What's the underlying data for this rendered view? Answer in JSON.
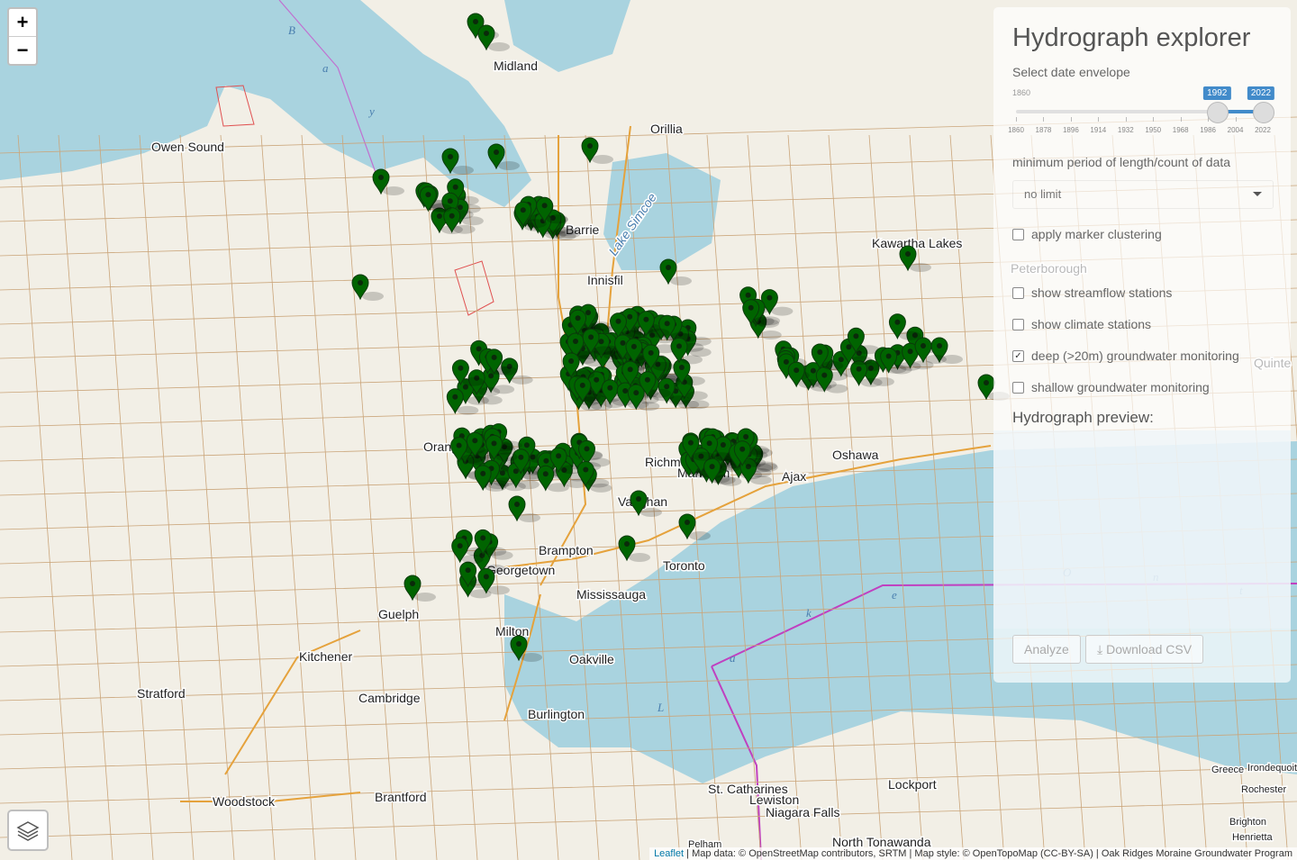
{
  "map": {
    "zoom_in": "+",
    "zoom_out": "−",
    "layers_icon": "layers-icon",
    "attribution": {
      "leaflet": "Leaflet",
      "text": " | Map data: © OpenStreetMap contributors, SRTM | Map style: © OpenTopoMap (CC-BY-SA) | Oak Ridges Moraine Groundwater Program"
    },
    "place_labels": [
      "Midland",
      "Owen Sound",
      "Orillia",
      "Barrie",
      "Lake Simcoe",
      "Innisfil",
      "Kawartha Lakes",
      "Peterborough",
      "Quinte",
      "Orangeville",
      "Richmond",
      "Markham",
      "Vaughan",
      "Brampton",
      "Georgetown",
      "Toronto",
      "Mississauga",
      "Ajax",
      "Oshawa",
      "Guelph",
      "Milton",
      "Kitchener",
      "Stratford",
      "Cambridge",
      "Oakville",
      "Burlington",
      "Woodstock",
      "Brantford",
      "St. Catharines",
      "Lewiston",
      "Niagara Falls",
      "Lockport",
      "North Tonawanda",
      "Pelham",
      "Greece",
      "Irondequoit",
      "Rochester",
      "Brighton",
      "Henrietta"
    ],
    "water_labels": [
      "B",
      "a",
      "y",
      "L",
      "a",
      "k",
      "e",
      "O",
      "n",
      "t"
    ],
    "marker_color": "#006400",
    "water_color": "#a9d3df",
    "land_color": "#f2efe6"
  },
  "panel": {
    "title": "Hydrograph explorer",
    "date_label": "Select date envelope",
    "slider": {
      "min": 1860,
      "max": 2022,
      "from": 1992,
      "to": 2022,
      "min_label": "1860",
      "from_label": "1992",
      "to_label": "2022",
      "ticks": [
        "1860",
        "1878",
        "1896",
        "1914",
        "1932",
        "1950",
        "1968",
        "1986",
        "2004",
        "2022"
      ]
    },
    "min_period_label": "minimum period of length/count of data",
    "min_period_value": "no limit",
    "checkboxes": [
      {
        "label": "apply marker clustering",
        "checked": false
      },
      {
        "label": "show streamflow stations",
        "checked": false
      },
      {
        "label": "show climate stations",
        "checked": false
      },
      {
        "label": "deep (>20m) groundwater monitoring",
        "checked": true
      },
      {
        "label": "shallow groundwater monitoring",
        "checked": false
      }
    ],
    "preview_label": "Hydrograph preview:",
    "analyze_button": "Analyze",
    "download_button": "Download CSV"
  }
}
